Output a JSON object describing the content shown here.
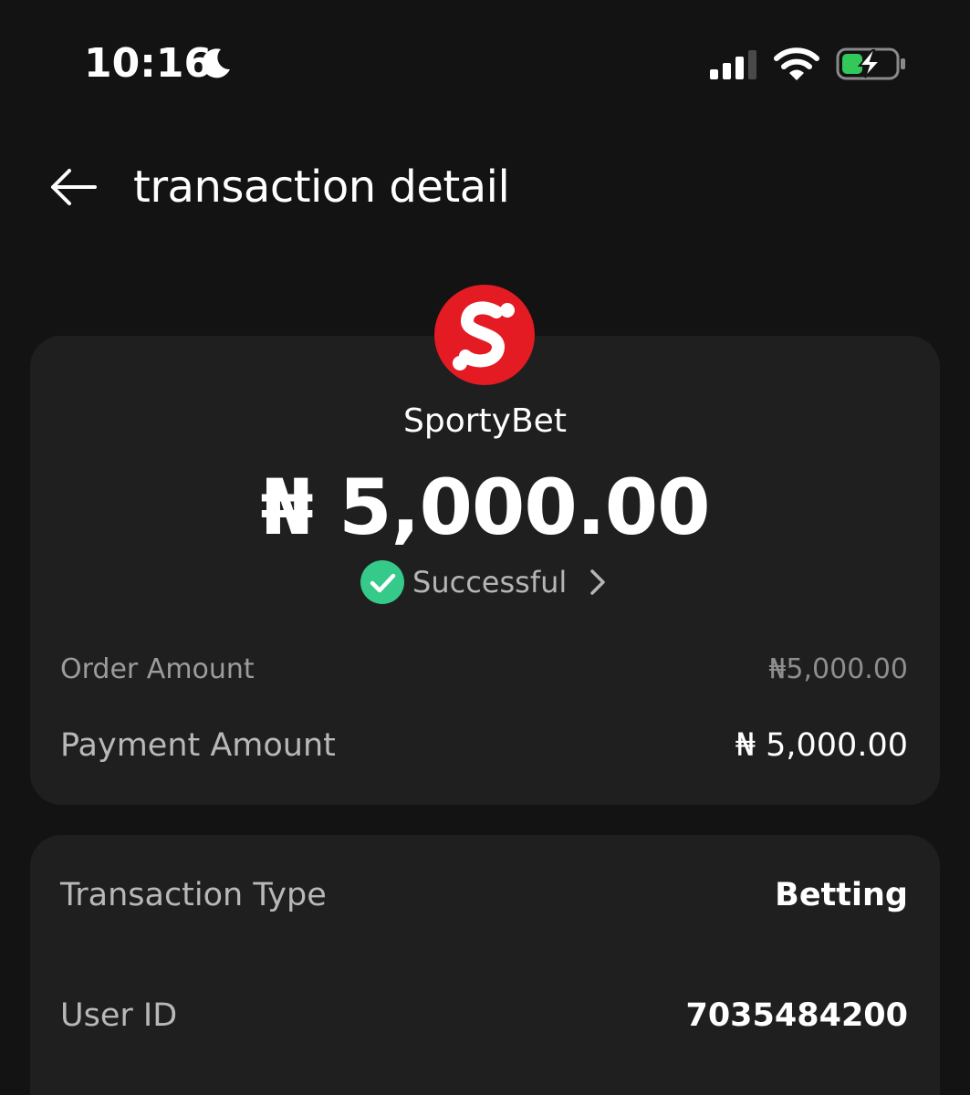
{
  "status_bar": {
    "time": "10:16",
    "icons": [
      "moon-icon",
      "signal-icon",
      "wifi-icon",
      "battery-charging-icon"
    ],
    "battery_color": "#33c95a"
  },
  "header": {
    "back_icon": "arrow-left-icon",
    "title": "transaction detail"
  },
  "summary": {
    "merchant_logo_icon": "sportybet-logo",
    "merchant_name": "SportyBet",
    "amount": "₦ 5,000.00",
    "status": "Successful",
    "status_icon": "check-circle-icon",
    "status_color": "#35c98a",
    "order_amount_label": "Order Amount",
    "order_amount_value": "₦5,000.00",
    "payment_amount_label": "Payment Amount",
    "payment_amount_value": "₦ 5,000.00"
  },
  "details": {
    "rows": [
      {
        "label": "Transaction Type",
        "value": "Betting"
      },
      {
        "label": "User ID",
        "value": "7035484200"
      }
    ]
  },
  "colors": {
    "background": "#131313",
    "card": "#1f1f1f",
    "brand_red": "#e41b23",
    "text_primary": "#ffffff",
    "text_secondary": "#b8b8b8"
  }
}
